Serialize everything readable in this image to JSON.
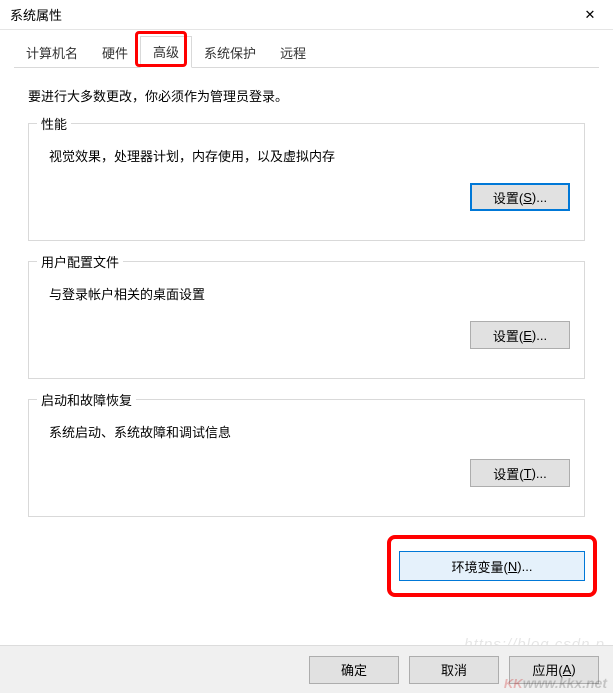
{
  "window": {
    "title": "系统属性",
    "close_icon": "✕"
  },
  "tabs": {
    "items": [
      {
        "label": "计算机名"
      },
      {
        "label": "硬件"
      },
      {
        "label": "高级"
      },
      {
        "label": "系统保护"
      },
      {
        "label": "远程"
      }
    ],
    "active_index": 2
  },
  "intro_text": "要进行大多数更改，你必须作为管理员登录。",
  "groups": {
    "performance": {
      "legend": "性能",
      "desc": "视觉效果，处理器计划，内存使用，以及虚拟内存",
      "button_prefix": "设置(",
      "button_key": "S",
      "button_suffix": ")..."
    },
    "userprofile": {
      "legend": "用户配置文件",
      "desc": "与登录帐户相关的桌面设置",
      "button_prefix": "设置(",
      "button_key": "E",
      "button_suffix": ")..."
    },
    "startup": {
      "legend": "启动和故障恢复",
      "desc": "系统启动、系统故障和调试信息",
      "button_prefix": "设置(",
      "button_key": "T",
      "button_suffix": ")..."
    }
  },
  "envvar": {
    "button_prefix": "环境变量(",
    "button_key": "N",
    "button_suffix": ")..."
  },
  "footer": {
    "ok": "确定",
    "cancel": "取消",
    "apply_prefix": "应用(",
    "apply_key": "A",
    "apply_suffix": ")"
  },
  "watermark_url": "https://blog.csdn.p",
  "watermark_site": "www.kkx.net"
}
